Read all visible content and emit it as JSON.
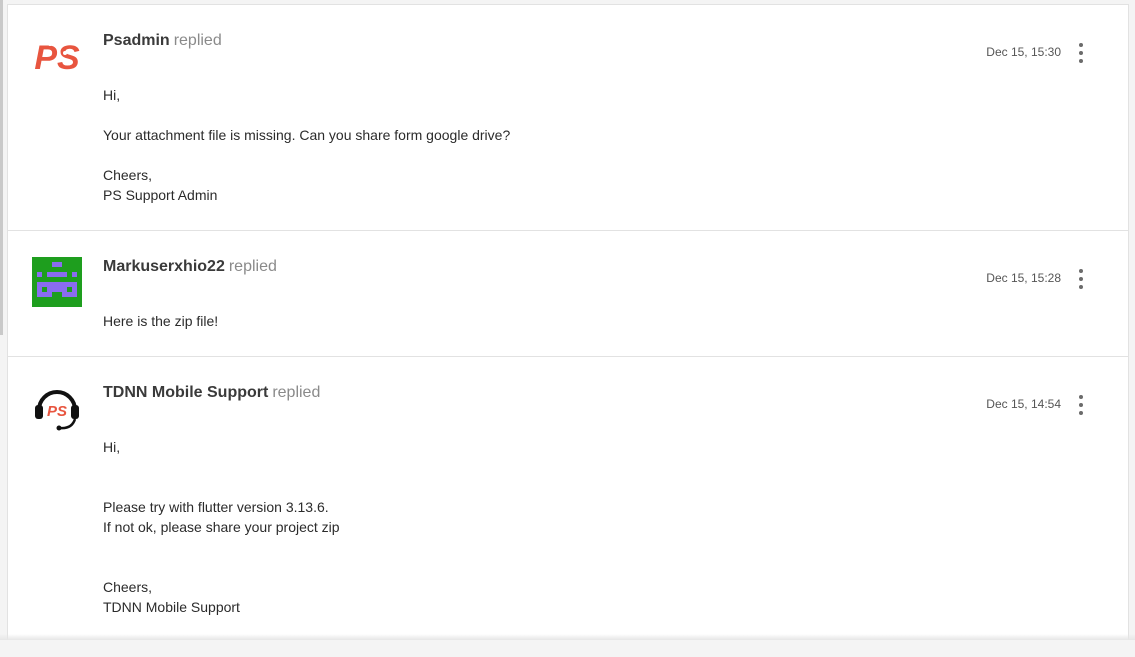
{
  "replies": [
    {
      "author": "Psadmin",
      "action": "replied",
      "timestamp": "Dec 15, 15:30",
      "avatar_icon": "ps-logo-icon",
      "body_lines": [
        "Hi,",
        "",
        "Your attachment file is missing. Can you share form google drive?",
        "",
        "Cheers,",
        "PS Support Admin"
      ]
    },
    {
      "author": "Markuserxhio22",
      "action": "replied",
      "timestamp": "Dec 15, 15:28",
      "avatar_icon": "pixel-identicon",
      "body_lines": [
        "Here is the zip file!"
      ]
    },
    {
      "author": "TDNN Mobile Support",
      "action": "replied",
      "timestamp": "Dec 15, 14:54",
      "avatar_icon": "support-headset-icon",
      "body_lines": [
        "Hi,",
        "",
        "",
        "Please try with flutter version 3.13.6.",
        "If not ok, please share your project zip",
        "",
        "",
        "Cheers,",
        "TDNN Mobile Support"
      ]
    }
  ],
  "colors": {
    "brand_red": "#e8553f",
    "identicon_bg": "#1e9e1e",
    "identicon_fg": "#8a6cf0"
  },
  "menu_icon": "more-vertical-icon"
}
